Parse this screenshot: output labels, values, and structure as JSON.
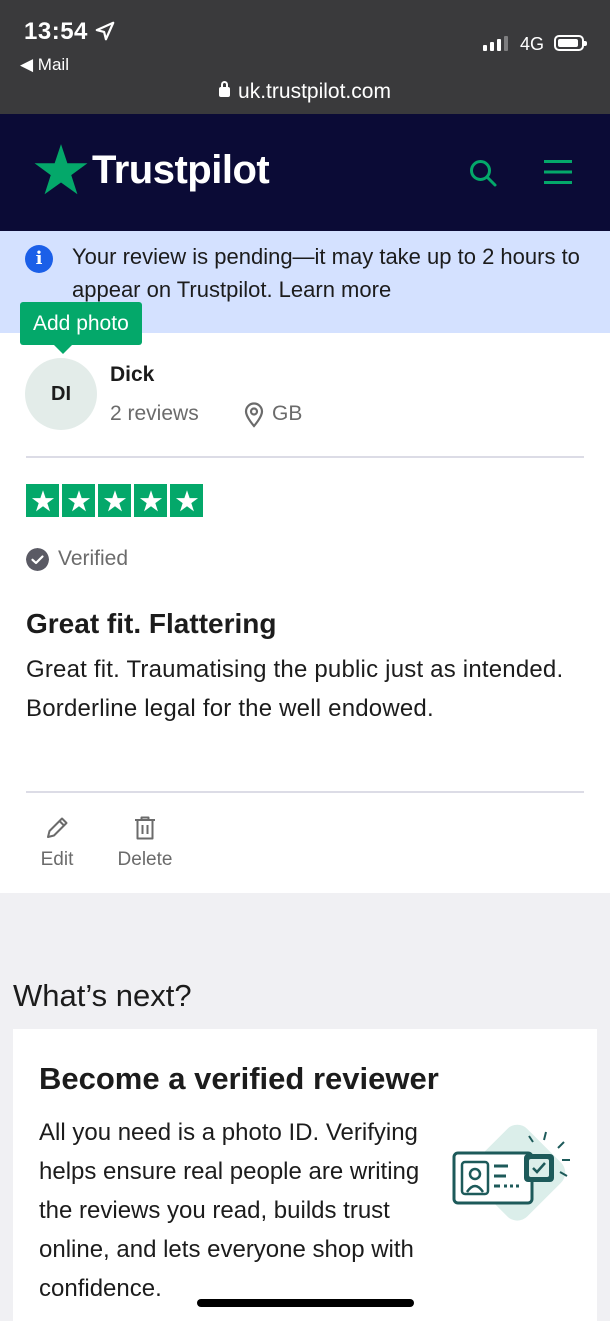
{
  "status_bar": {
    "time": "13:54",
    "back_label": "◀ Mail",
    "network": "4G",
    "url": "uk.trustpilot.com"
  },
  "header": {
    "logo_text": "Trustpilot",
    "brand_color": "#04a86a",
    "bg_color": "#0b0b36",
    "icons": [
      "search-icon",
      "hamburger-menu-icon"
    ]
  },
  "banner": {
    "text": "Your review is pending—it may take up to 2 hours to appear on Trustpilot. Learn more",
    "icon": "info-icon"
  },
  "review": {
    "add_photo_label": "Add photo",
    "avatar_initials": "DI",
    "user_name": "Dick",
    "reviews_count": "2 reviews",
    "country": "GB",
    "rating": 5,
    "rating_max": 5,
    "verified_label": "Verified",
    "title": "Great fit. Flattering",
    "body": "Great fit. Traumatising the public just as intended. Borderline legal for the well endowed.",
    "edit_label": "Edit",
    "delete_label": "Delete"
  },
  "whats_next": {
    "heading": "What’s next?",
    "card_title": "Become a verified reviewer",
    "card_body": "All you need is a photo ID. Verifying helps ensure real people are writing the reviews you read, builds trust online, and lets everyone shop with confidence."
  }
}
